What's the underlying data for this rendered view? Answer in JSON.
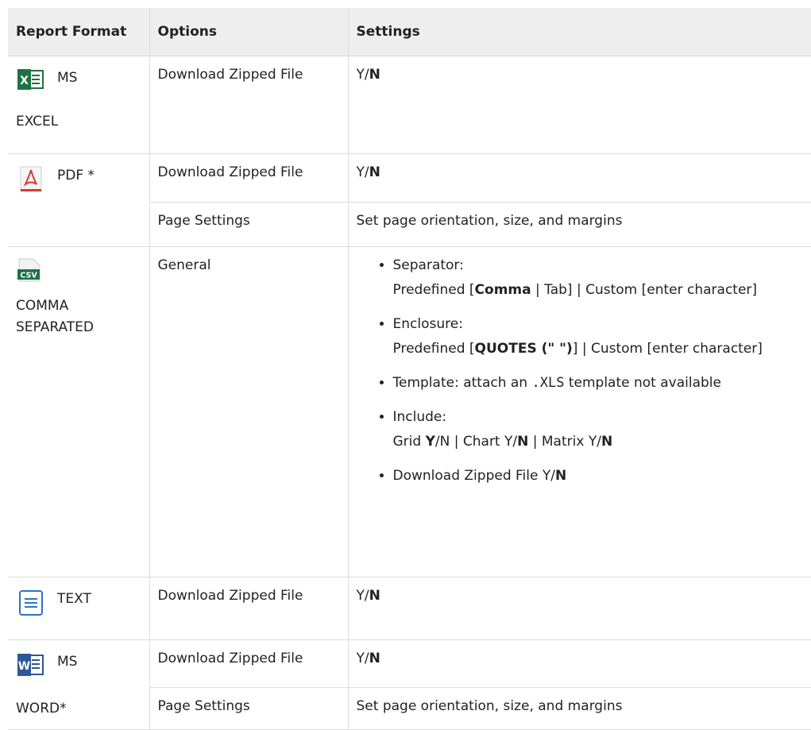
{
  "headers": {
    "format": "Report Format",
    "options": "Options",
    "settings": "Settings"
  },
  "excel": {
    "name": "MS",
    "name2": "EXCEL",
    "option": "Download Zipped File",
    "y": "Y/",
    "n": "N"
  },
  "pdf": {
    "name": "PDF *",
    "option1": "Download Zipped File",
    "y": "Y/",
    "n": "N",
    "option2": "Page Settings",
    "setting2": "Set page orientation, size, and margins"
  },
  "csv": {
    "icon_text": "CSV",
    "name1": "COMMA",
    "name2": "SEPARATED",
    "option": "General",
    "separator": {
      "label": "Separator:",
      "pre": "Predefined [",
      "comma": "Comma",
      "post": " | Tab] | Custom [enter character]"
    },
    "enclosure": {
      "label": "Enclosure:",
      "pre": "Predefined [",
      "quotes": "QUOTES (\" \")",
      "post": "] | Custom [enter character]"
    },
    "template": {
      "pre": "Template: attach an ",
      "ext": ".XLS",
      "post": " template not available"
    },
    "include": {
      "label": "Include:",
      "grid": "Grid ",
      "grid_y": "Y",
      "grid_n": "/N | Chart Y/",
      "chart_n": "N",
      "matrix": " | Matrix Y/",
      "matrix_n": "N"
    },
    "download": {
      "label": "Download Zipped File Y/",
      "n": "N"
    }
  },
  "text": {
    "name": "TEXT",
    "option": "Download Zipped File",
    "y": "Y/",
    "n": "N"
  },
  "word": {
    "name": "MS",
    "name2": "WORD*",
    "option1": "Download Zipped File",
    "y": "Y/",
    "n": "N",
    "option2": "Page Settings",
    "setting2": "Set page orientation, size, and margins"
  },
  "colors": {
    "excel": "#1e7145",
    "pdf": "#d9392d",
    "csv": "#1e7145",
    "text": "#2b73c7",
    "word": "#2b579a"
  }
}
